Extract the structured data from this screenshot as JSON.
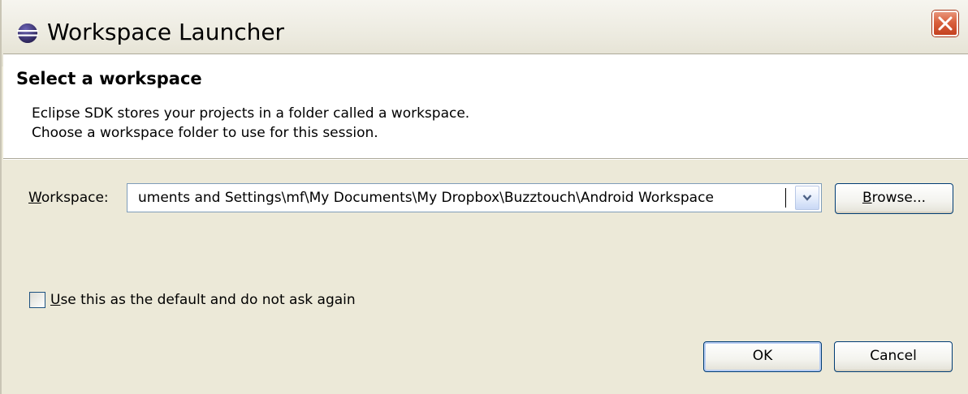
{
  "window": {
    "title": "Workspace Launcher",
    "icon": "eclipse-icon",
    "close_icon": "close-icon"
  },
  "header": {
    "title": "Select a workspace",
    "description_line1": "Eclipse SDK stores your projects in a folder called a workspace.",
    "description_line2": "Choose a workspace folder to use for this session."
  },
  "workspace": {
    "label_mnemonic": "W",
    "label_rest": "orkspace:",
    "value": "uments and Settings\\mf\\My Documents\\My Dropbox\\Buzztouch\\Android Workspace",
    "dropdown_icon": "chevron-down-icon"
  },
  "buttons": {
    "browse_mnemonic": "B",
    "browse_rest": "rowse...",
    "ok": "OK",
    "cancel": "Cancel"
  },
  "default_checkbox": {
    "label_mnemonic": "U",
    "label_rest": "se this as the default and do not ask again",
    "checked": false
  },
  "colors": {
    "dialog_background": "#ece9d8",
    "close_button": "#d9603d",
    "input_border": "#7f9db9",
    "button_border": "#003c74"
  }
}
